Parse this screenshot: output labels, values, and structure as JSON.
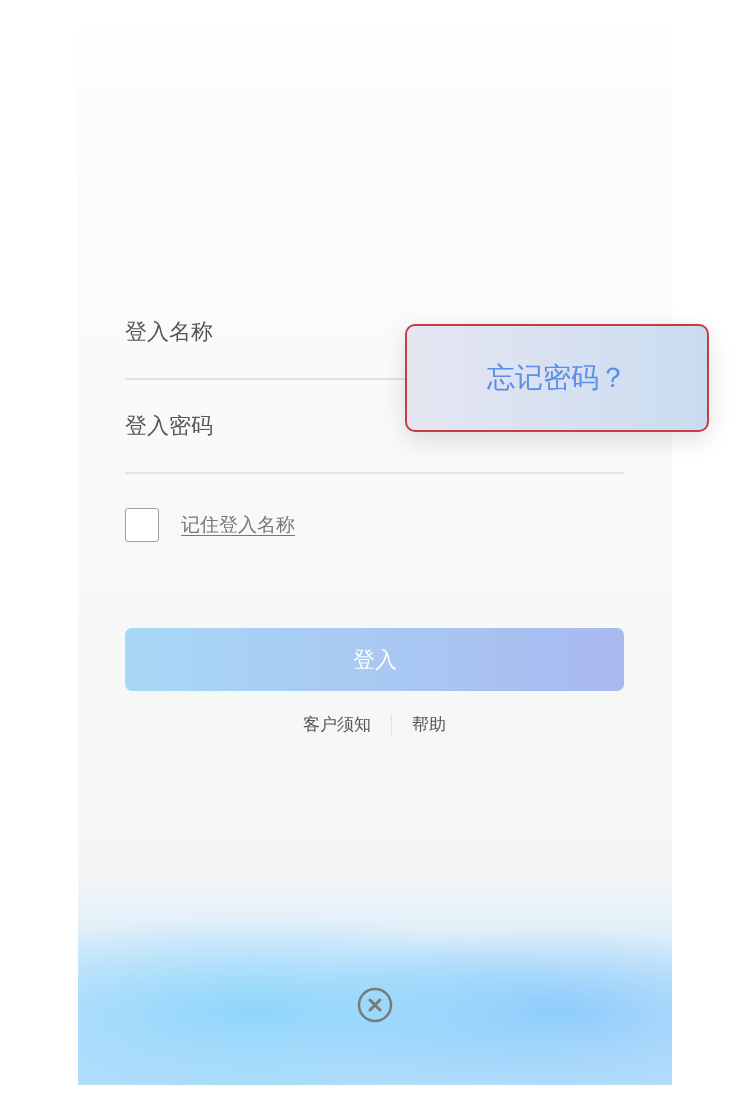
{
  "fields": [
    {
      "placeholder": "登入名称"
    },
    {
      "placeholder": "登入密码"
    }
  ],
  "remember": {
    "label": "记住登入名称",
    "checked": false
  },
  "login_button": "登入",
  "links": [
    "客户须知",
    "帮助"
  ],
  "popup": {
    "text": "忘记密码？"
  }
}
